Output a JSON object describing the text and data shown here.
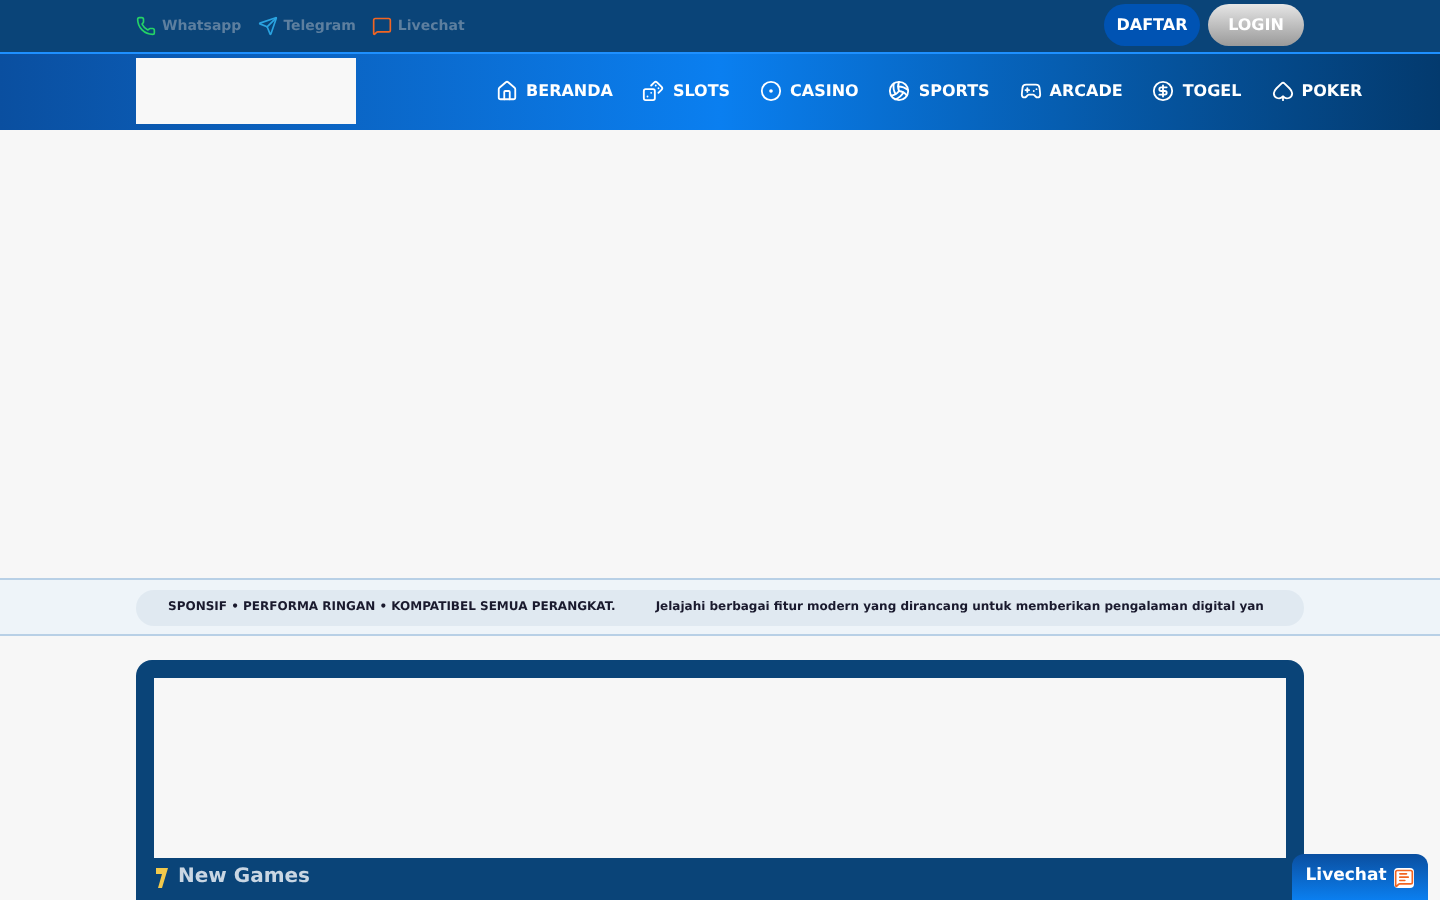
{
  "top_links": [
    {
      "label": "Whatsapp",
      "kind": "whatsapp"
    },
    {
      "label": "Telegram",
      "kind": "telegram"
    },
    {
      "label": "Livechat",
      "kind": "chat"
    }
  ],
  "auth_buttons": [
    {
      "label": "DAFTAR",
      "kind": "primary"
    },
    {
      "label": "LOGIN",
      "kind": "secondary"
    }
  ],
  "nav": [
    {
      "label": "BERANDA",
      "kind": "home"
    },
    {
      "label": "SLOTS",
      "kind": "slots"
    },
    {
      "label": "CASINO",
      "kind": "casino"
    },
    {
      "label": "SPORTS",
      "kind": "sports"
    },
    {
      "label": "ARCADE",
      "kind": "arcade"
    },
    {
      "label": "TOGEL",
      "kind": "togel"
    },
    {
      "label": "POKER",
      "kind": "poker"
    }
  ],
  "ticker": {
    "label": "SPONSIF • PERFORMA RINGAN • KOMPATIBEL SEMUA PERANGKAT.",
    "message": "Jelajahi berbagai fitur modern yang dirancang untuk memberikan pengalaman digital yan"
  },
  "section": {
    "title": "New Games"
  },
  "livechat_button": {
    "label": "Livechat"
  }
}
